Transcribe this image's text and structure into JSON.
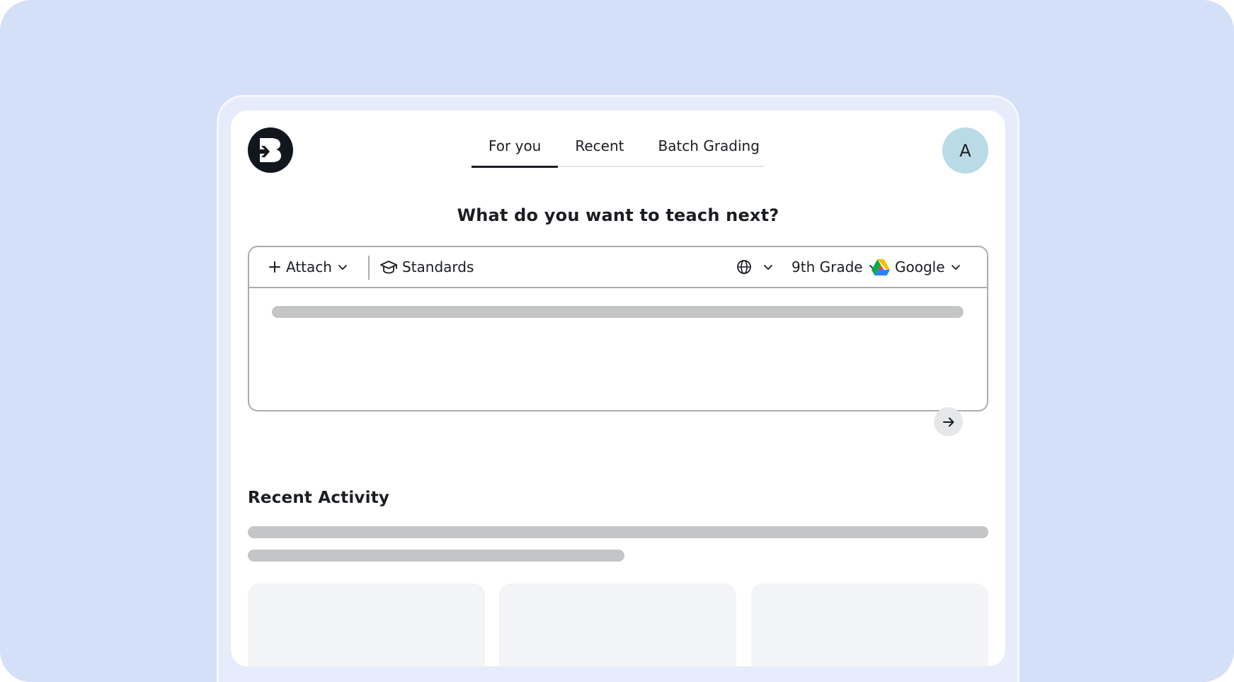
{
  "app": {
    "logo_icon": "brand-b-logo-icon",
    "accent_color": "#11171d",
    "backdrop_color": "#d4dff8"
  },
  "nav": {
    "tabs": [
      {
        "label": "For you",
        "active": true
      },
      {
        "label": "Recent",
        "active": false
      },
      {
        "label": "Batch Grading",
        "active": false
      }
    ]
  },
  "user": {
    "avatar_initial": "A",
    "avatar_color": "#b8dbe6"
  },
  "main": {
    "headline": "What do you want to teach next?",
    "composer": {
      "attach_label": "Attach",
      "attach_icon": "plus-icon",
      "standards_label": "Standards",
      "standards_icon": "graduation-cap-icon",
      "language_icon": "globe-icon",
      "grade_label": "9th Grade",
      "export_label": "Google",
      "export_icon": "google-drive-icon",
      "send_icon": "arrow-right-icon"
    },
    "recent_activity_title": "Recent Activity"
  }
}
